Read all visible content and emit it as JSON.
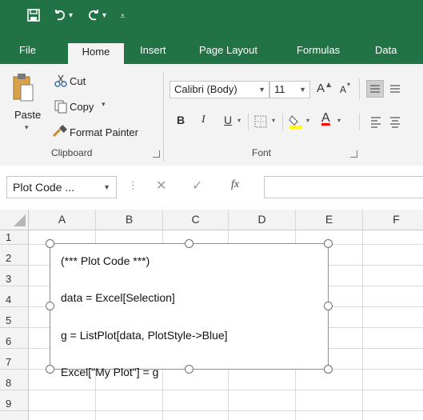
{
  "ribbon_tabs": [
    "File",
    "Home",
    "Insert",
    "Page Layout",
    "Formulas",
    "Data"
  ],
  "clipboard": {
    "paste_label": "Paste",
    "cut_label": "Cut",
    "copy_label": "Copy",
    "format_painter_label": "Format Painter",
    "group_label": "Clipboard"
  },
  "font": {
    "family": "Calibri (Body)",
    "size": "11",
    "grow_label": "A",
    "shrink_label": "A",
    "bold_label": "B",
    "italic_label": "I",
    "underline_label": "U",
    "group_label": "Font",
    "font_color_label": "A",
    "font_color": "#ff0000",
    "fill_color": "#ffff00"
  },
  "formula_bar": {
    "name_box": "Plot Code ...",
    "fx_label": "fx",
    "value": ""
  },
  "columns": [
    "A",
    "B",
    "C",
    "D",
    "E",
    "F"
  ],
  "rows": [
    "1",
    "2",
    "3",
    "4",
    "5",
    "6",
    "7",
    "8",
    "9"
  ],
  "shape_text": [
    "(*** Plot Code ***)",
    "data = Excel[Selection]",
    "g = ListPlot[data, PlotStyle->Blue]",
    "Excel[\"My Plot\"] = g"
  ],
  "colors": {
    "title_bar": "#217346",
    "ribbon": "#f3f3f3"
  }
}
